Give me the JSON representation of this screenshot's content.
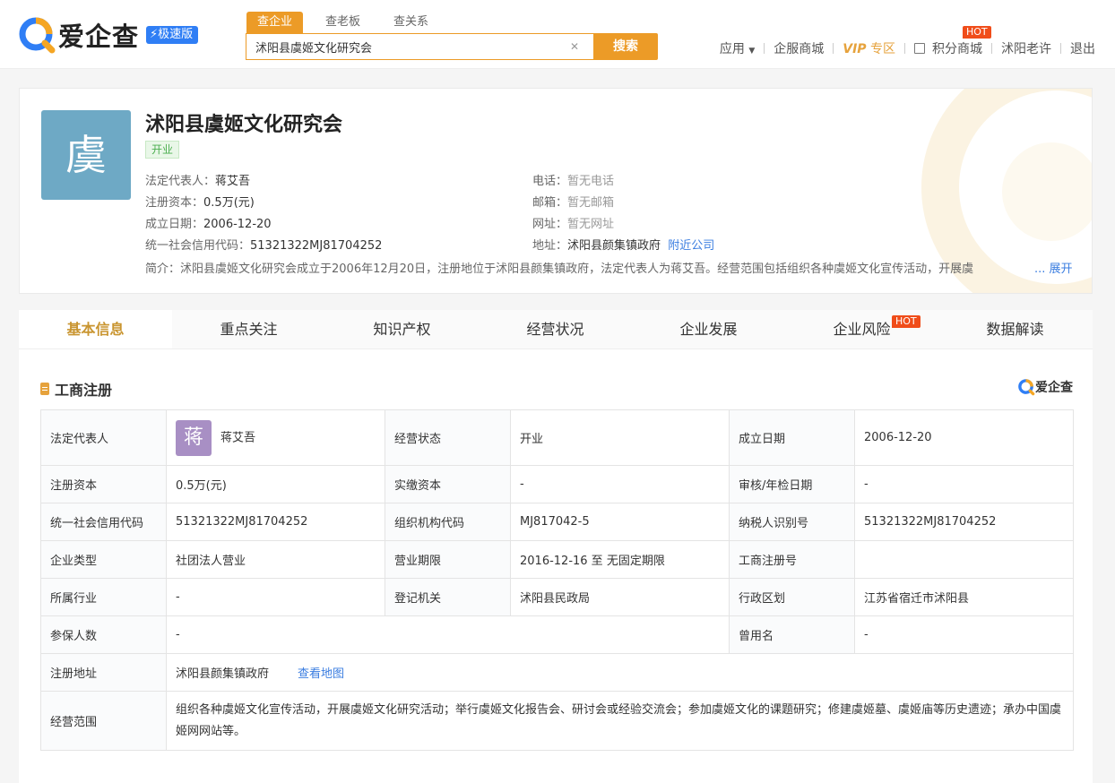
{
  "header": {
    "logo_text": "爱企查",
    "fast_badge": "极速版",
    "search_tabs": [
      "查企业",
      "查老板",
      "查关系"
    ],
    "search_value": "沭阳县虞姬文化研究会",
    "search_button": "搜索",
    "nav": {
      "apps": "应用",
      "mall": "企服商城",
      "vip": "VIP",
      "vip_zone": "专区",
      "points": "积分商城",
      "hot": "HOT",
      "user": "沭阳老许",
      "logout": "退出"
    }
  },
  "company": {
    "avatar_char": "虞",
    "name": "沭阳县虞姬文化研究会",
    "status": "开业",
    "legal_rep_label": "法定代表人：",
    "legal_rep": "蒋艾吾",
    "capital_label": "注册资本：",
    "capital": "0.5万(元)",
    "founded_label": "成立日期：",
    "founded": "2006-12-20",
    "credit_code_label": "统一社会信用代码：",
    "credit_code": "51321322MJ81704252",
    "phone_label": "电话：",
    "phone": "暂无电话",
    "email_label": "邮箱：",
    "email": "暂无邮箱",
    "website_label": "网址：",
    "website": "暂无网址",
    "address_label": "地址：",
    "address": "沭阳县颜集镇政府",
    "nearby": "附近公司",
    "intro": "简介：沭阳县虞姬文化研究会成立于2006年12月20日，注册地位于沭阳县颜集镇政府，法定代表人为蒋艾吾。经营范围包括组织各种虞姬文化宣传活动，开展虞",
    "intro_more": "... 展开"
  },
  "tabs": [
    "基本信息",
    "重点关注",
    "知识产权",
    "经营状况",
    "企业发展",
    "企业风险",
    "数据解读"
  ],
  "tab_hot": "HOT",
  "section": {
    "title": "工商注册",
    "brand": "爱企查"
  },
  "table": {
    "r1": {
      "l1": "法定代表人",
      "person_char": "蒋",
      "v1": "蒋艾吾",
      "l2": "经营状态",
      "v2": "开业",
      "l3": "成立日期",
      "v3": "2006-12-20"
    },
    "r2": {
      "l1": "注册资本",
      "v1": "0.5万(元)",
      "l2": "实缴资本",
      "v2": "-",
      "l3": "审核/年检日期",
      "v3": "-"
    },
    "r3": {
      "l1": "统一社会信用代码",
      "v1": "51321322MJ81704252",
      "l2": "组织机构代码",
      "v2": "MJ817042-5",
      "l3": "纳税人识别号",
      "v3": "51321322MJ81704252"
    },
    "r4": {
      "l1": "企业类型",
      "v1": "社团法人营业",
      "l2": "营业期限",
      "v2": "2016-12-16 至 无固定期限",
      "l3": "工商注册号",
      "v3": ""
    },
    "r5": {
      "l1": "所属行业",
      "v1": "-",
      "l2": "登记机关",
      "v2": "沭阳县民政局",
      "l3": "行政区划",
      "v3": "江苏省宿迁市沭阳县"
    },
    "r6": {
      "l1": "参保人数",
      "v1": "-",
      "l3": "曾用名",
      "v3": "-"
    },
    "r7": {
      "l1": "注册地址",
      "v1": "沭阳县颜集镇政府",
      "map": "查看地图"
    },
    "r8": {
      "l1": "经营范围",
      "v1": "组织各种虞姬文化宣传活动，开展虞姬文化研究活动；举行虞姬文化报告会、研讨会或经验交流会；参加虞姬文化的课题研究；修建虞姬墓、虞姬庙等历史遗迹；承办中国虞姬网网站等。"
    }
  }
}
